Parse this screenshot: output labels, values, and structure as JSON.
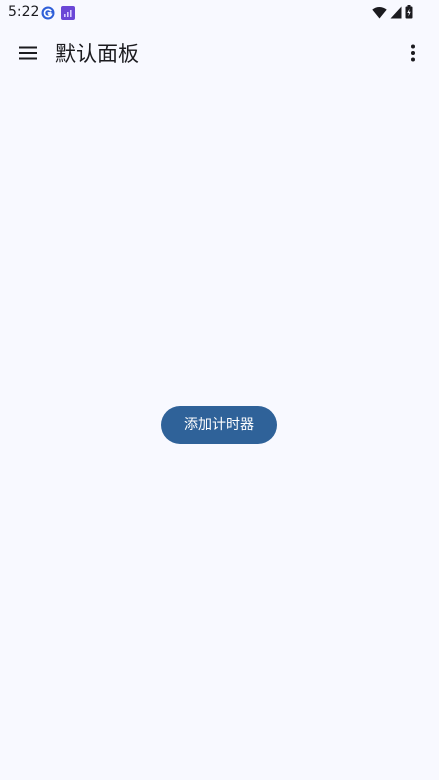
{
  "status_bar": {
    "time": "5:22",
    "left_icons": [
      "browser-app-icon",
      "purple-app-icon"
    ],
    "right_icons": [
      "wifi-icon",
      "cellular-signal-icon",
      "battery-icon"
    ]
  },
  "app_bar": {
    "title": "默认面板",
    "menu_icon": "menu-icon",
    "overflow_icon": "more-vert-icon"
  },
  "content": {
    "add_timer_label": "添加计时器"
  },
  "colors": {
    "background": "#f8f9ff",
    "primary_button": "#2f6299",
    "on_primary": "#ffffff",
    "text": "#1b1b1f"
  }
}
